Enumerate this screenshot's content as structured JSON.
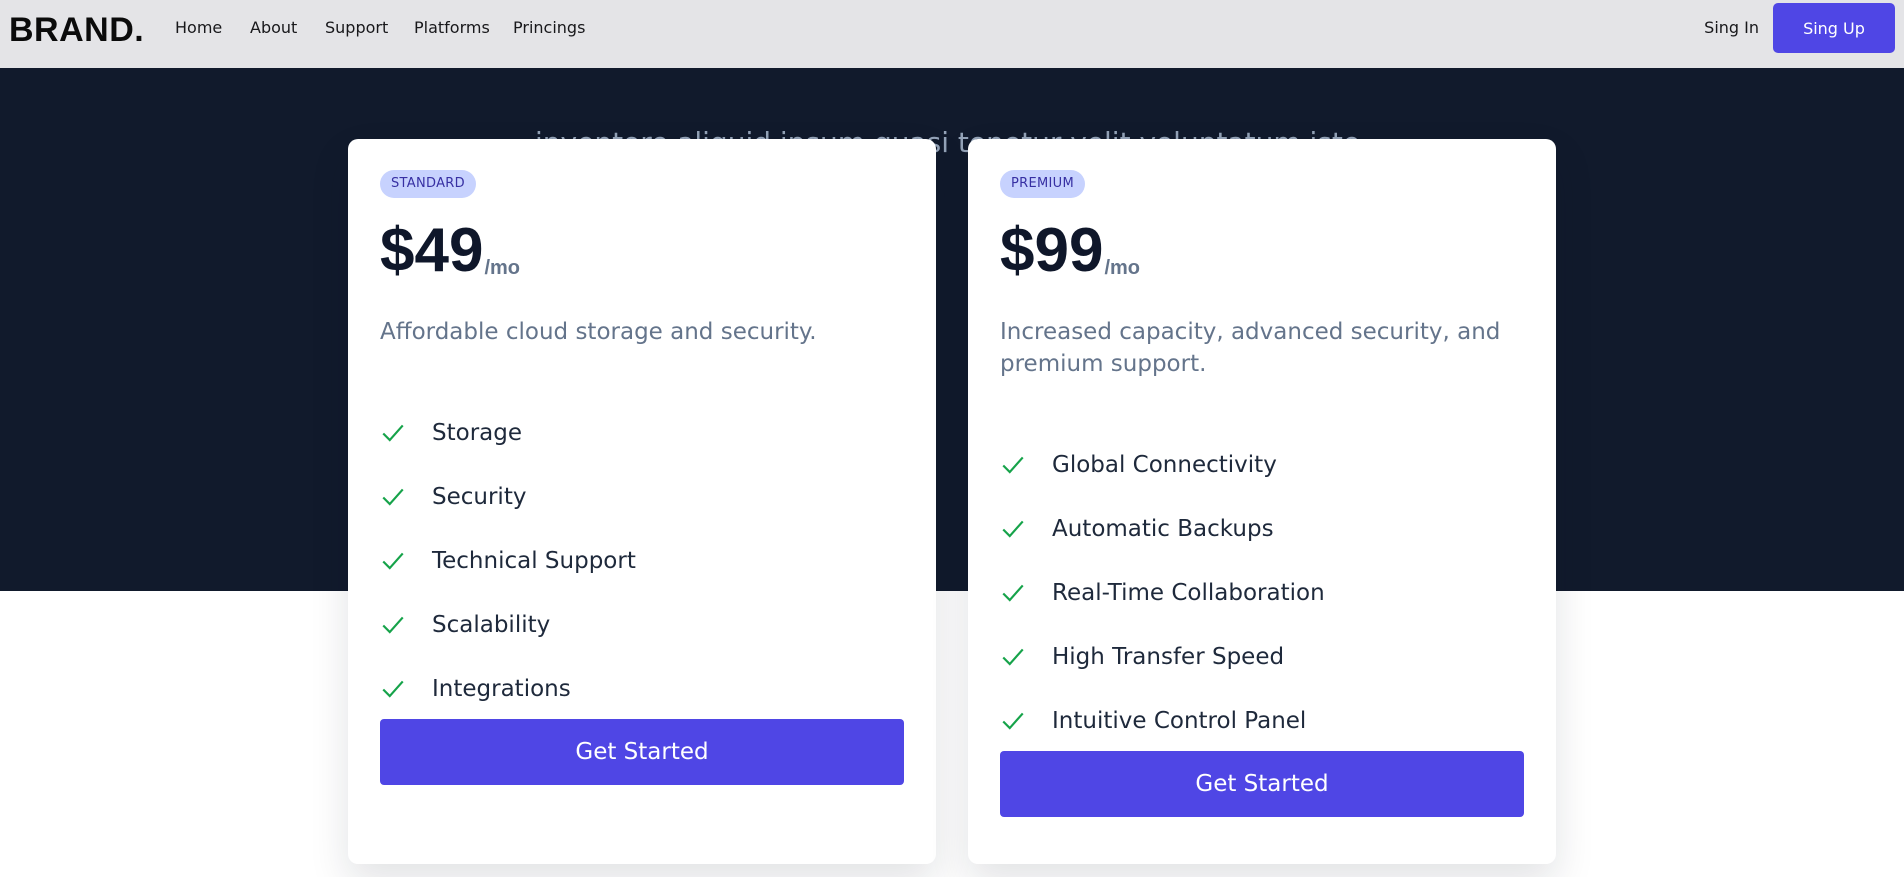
{
  "nav": {
    "brand": "BRAND.",
    "links": [
      "Home",
      "About",
      "Support",
      "Platforms",
      "Princings"
    ],
    "signin": "Sing In",
    "signup": "Sing Up"
  },
  "hero": {
    "subtitle": "inventore aliquid ipsum quasi tenetur velit voluptatum iste."
  },
  "plans": [
    {
      "badge": "STANDARD",
      "price": "$49",
      "period": "/mo",
      "description": "Affordable cloud storage and security.",
      "features": [
        "Storage",
        "Security",
        "Technical Support",
        "Scalability",
        "Integrations"
      ],
      "cta": "Get Started"
    },
    {
      "badge": "PREMIUM",
      "price": "$99",
      "period": "/mo",
      "description": "Increased capacity, advanced security, and premium support.",
      "features": [
        "Global Connectivity",
        "Automatic Backups",
        "Real-Time Collaboration",
        "High Transfer Speed",
        "Intuitive Control Panel"
      ],
      "cta": "Get Started"
    }
  ],
  "icons": {
    "feature": "check-icon"
  },
  "colors": {
    "accent": "#4f46e5",
    "hero_bg": "#111a2c",
    "check": "#16a34a",
    "badge_bg": "#c7d2fe",
    "badge_text": "#3730a3"
  }
}
